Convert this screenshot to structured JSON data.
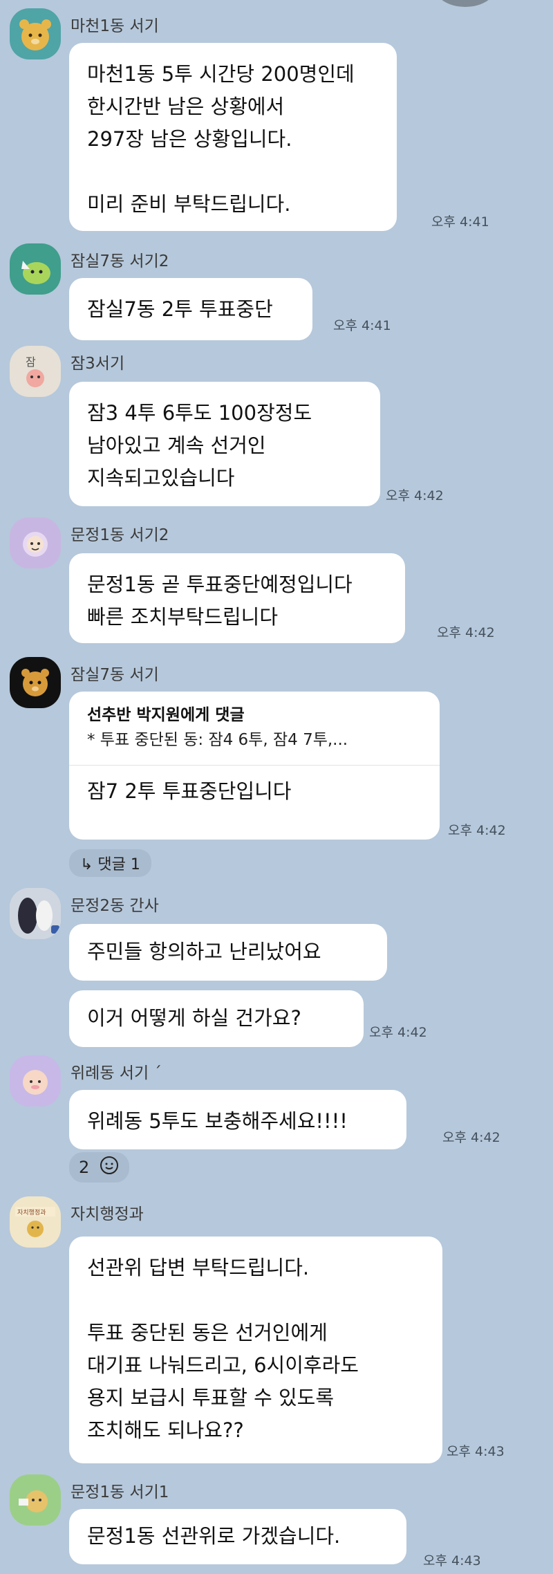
{
  "messages": [
    {
      "sender": "마천1동 서기",
      "avatar_icon": "bear-face-icon",
      "lines": [
        "마천1동 5투 시간당 200명인데",
        "한시간반 남은 상황에서",
        "297장 남은 상황입니다.",
        "",
        "미리 준비 부탁드립니다."
      ],
      "time": "오후 4:41"
    },
    {
      "sender": "잠실7동 서기2",
      "avatar_icon": "green-character-icon",
      "lines": [
        "잠실7동 2투 투표중단"
      ],
      "time": "오후 4:41"
    },
    {
      "sender": "잠3서기",
      "avatar_icon": "pink-character-icon",
      "avatar_text": "잠",
      "lines": [
        "잠3 4투 6투도 100장정도",
        "남아있고 계속 선거인",
        "지속되고있습니다"
      ],
      "time": "오후 4:42"
    },
    {
      "sender": "문정1동 서기2",
      "avatar_icon": "purple-character-icon",
      "lines": [
        "문정1동 곧 투표중단예정입니다",
        "빠른 조치부탁드립니다"
      ],
      "time": "오후 4:42"
    },
    {
      "sender": "잠실7동 서기",
      "avatar_icon": "bear-dark-icon",
      "reply_head": "선추반 박지원에게 댓글",
      "reply_sub": "* 투표 중단된 동: 잠4 6투, 잠4 7투,...",
      "lines": [
        "잠7 2투 투표중단입니다"
      ],
      "time": "오후 4:42",
      "comment": "↳ 댓글 1"
    },
    {
      "sender": "문정2동 간사",
      "avatar_icon": "photo-avatar-icon",
      "lines": [
        "주민들 항의하고 난리났어요"
      ],
      "lines2": [
        "이거 어떻게 하실 건가요?"
      ],
      "time": "오후 4:42"
    },
    {
      "sender": "위례동 서기 ´",
      "avatar_icon": "pink-face-icon",
      "lines": [
        "위례동 5투도 보충해주세요!!!!"
      ],
      "time": "오후 4:42",
      "reaction_count": "2"
    },
    {
      "sender": "자치행정과",
      "avatar_icon": "govt-logo-icon",
      "avatar_text": "자치행정과",
      "lines": [
        "선관위 답변 부탁드립니다.",
        "",
        "투표 중단된 동은 선거인에게",
        "대기표 나눠드리고, 6시이후라도",
        "용지 보급시 투표할 수 있도록",
        "조치해도 되나요??"
      ],
      "time": "오후 4:43"
    },
    {
      "sender": "문정1동 서기1",
      "avatar_icon": "green-bear-icon",
      "lines": [
        "문정1동 선관위로 가겠습니다."
      ],
      "time": "오후 4:43"
    }
  ]
}
